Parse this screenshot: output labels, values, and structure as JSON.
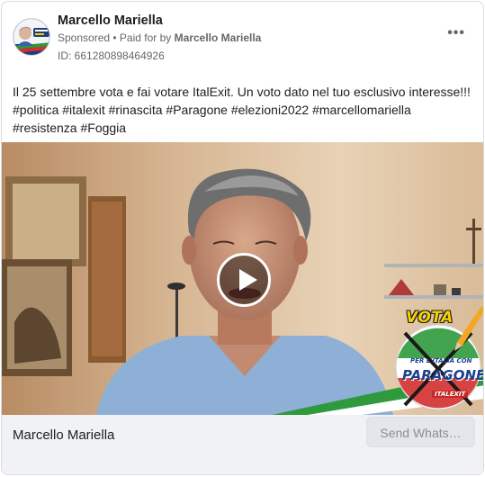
{
  "post": {
    "author": "Marcello Mariella",
    "sponsored": "Sponsored",
    "separator": " • ",
    "paid_for_prefix": "Paid for by ",
    "paid_for_name": "Marcello Mariella",
    "ad_id": "ID: 661280898464926",
    "more_icon": "more-dots-icon",
    "caption_line1": "Il 25 settembre vota e fai votare ItalExit. Un voto dato nel tuo esclusivo interesse!!!",
    "caption_line2": "#politica #italexit #rinascita #Paragone #elezioni2022 #marcellomariella",
    "caption_line3": "#resistenza #Foggia"
  },
  "video": {
    "overlay_vota": "VOTA",
    "logo_sub": "PER L'ITALIA CON",
    "logo_main": "PARAGONE",
    "logo_brand": "ITALEXIT",
    "play_icon": "play-icon"
  },
  "footer": {
    "page_name": "Marcello Mariella",
    "cta_label": "Send Whats…"
  },
  "colors": {
    "accent_green": "#2e9a3b",
    "accent_red": "#d32f2f",
    "logo_blue": "#1d3f8f",
    "vota_yellow": "#f5d100"
  }
}
